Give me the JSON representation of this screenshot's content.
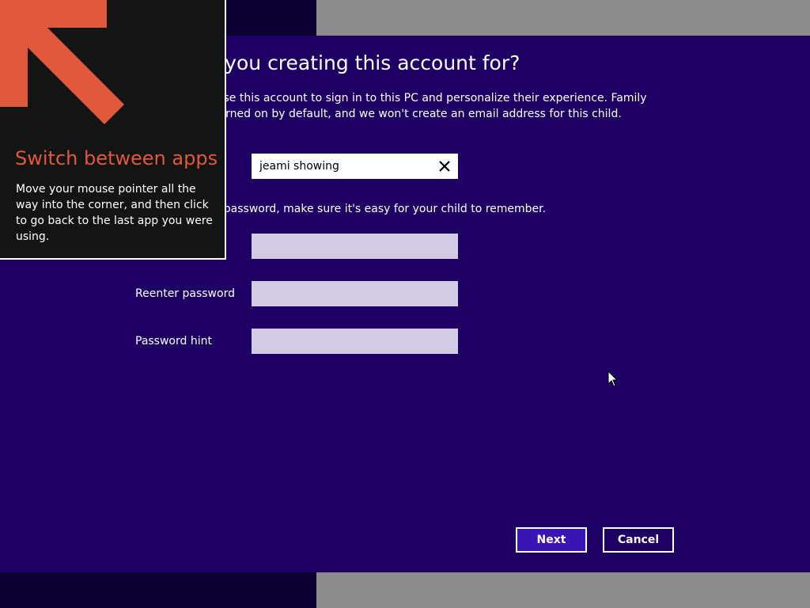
{
  "dialog": {
    "title": "Who are you creating this account for?",
    "description": "Your child can use this account to sign in to this PC and personalize their experience. Family Safety will be turned on by default, and we won't create an email address for this child.",
    "password_tip": "If you choose a password, make sure it's easy for your child to remember."
  },
  "form": {
    "username": {
      "value": "jeami showing"
    },
    "password_field": {
      "value": ""
    },
    "reenter_password": {
      "label": "Reenter password",
      "value": ""
    },
    "password_hint": {
      "label": "Password hint",
      "value": ""
    }
  },
  "buttons": {
    "next_label": "Next",
    "cancel_label": "Cancel"
  },
  "tip": {
    "title": "Switch between apps",
    "body": "Move your mouse pointer all the way into the corner, and then click to go back to the last app you were using."
  },
  "icons": {
    "corner_arrow": "arrow-up-left-icon",
    "clear": "close-icon",
    "cursor": "mouse-pointer-icon"
  },
  "colors": {
    "dialog_background": "#1e0064",
    "tip_title": "#e2583a",
    "arrow": "#e2583a",
    "next_button": "#3a14b4",
    "field_background": "#d3cbe3"
  }
}
